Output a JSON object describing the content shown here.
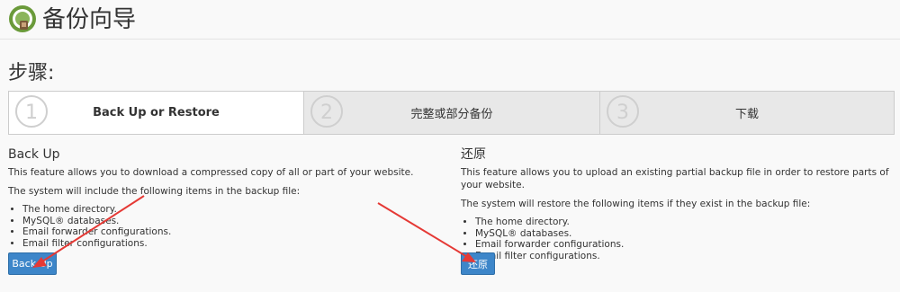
{
  "header": {
    "title": "备份向导",
    "icon": "backup-wizard-icon",
    "accent": "#6a9a3a"
  },
  "steps": {
    "heading": "步骤:",
    "items": [
      {
        "number": "1",
        "label": "Back Up or Restore",
        "active": true
      },
      {
        "number": "2",
        "label": "完整或部分备份",
        "active": false
      },
      {
        "number": "3",
        "label": "下载",
        "active": false
      }
    ]
  },
  "backup": {
    "title": "Back Up",
    "description": "This feature allows you to download a compressed copy of all or part of your website.",
    "include_text": "The system will include the following items in the backup file:",
    "items": [
      "The home directory.",
      "MySQL® databases.",
      "Email forwarder configurations.",
      "Email filter configurations."
    ],
    "button_label": "Back Up"
  },
  "restore": {
    "title": "还原",
    "description": "This feature allows you to upload an existing partial backup file in order to restore parts of your website.",
    "include_text": "The system will restore the following items if they exist in the backup file:",
    "items": [
      "The home directory.",
      "MySQL® databases.",
      "Email forwarder configurations.",
      "Email filter configurations."
    ],
    "button_label": "还原"
  },
  "colors": {
    "button": "#3d86c9",
    "arrow": "#e53935",
    "inactive_tab": "#e8e8e8"
  }
}
